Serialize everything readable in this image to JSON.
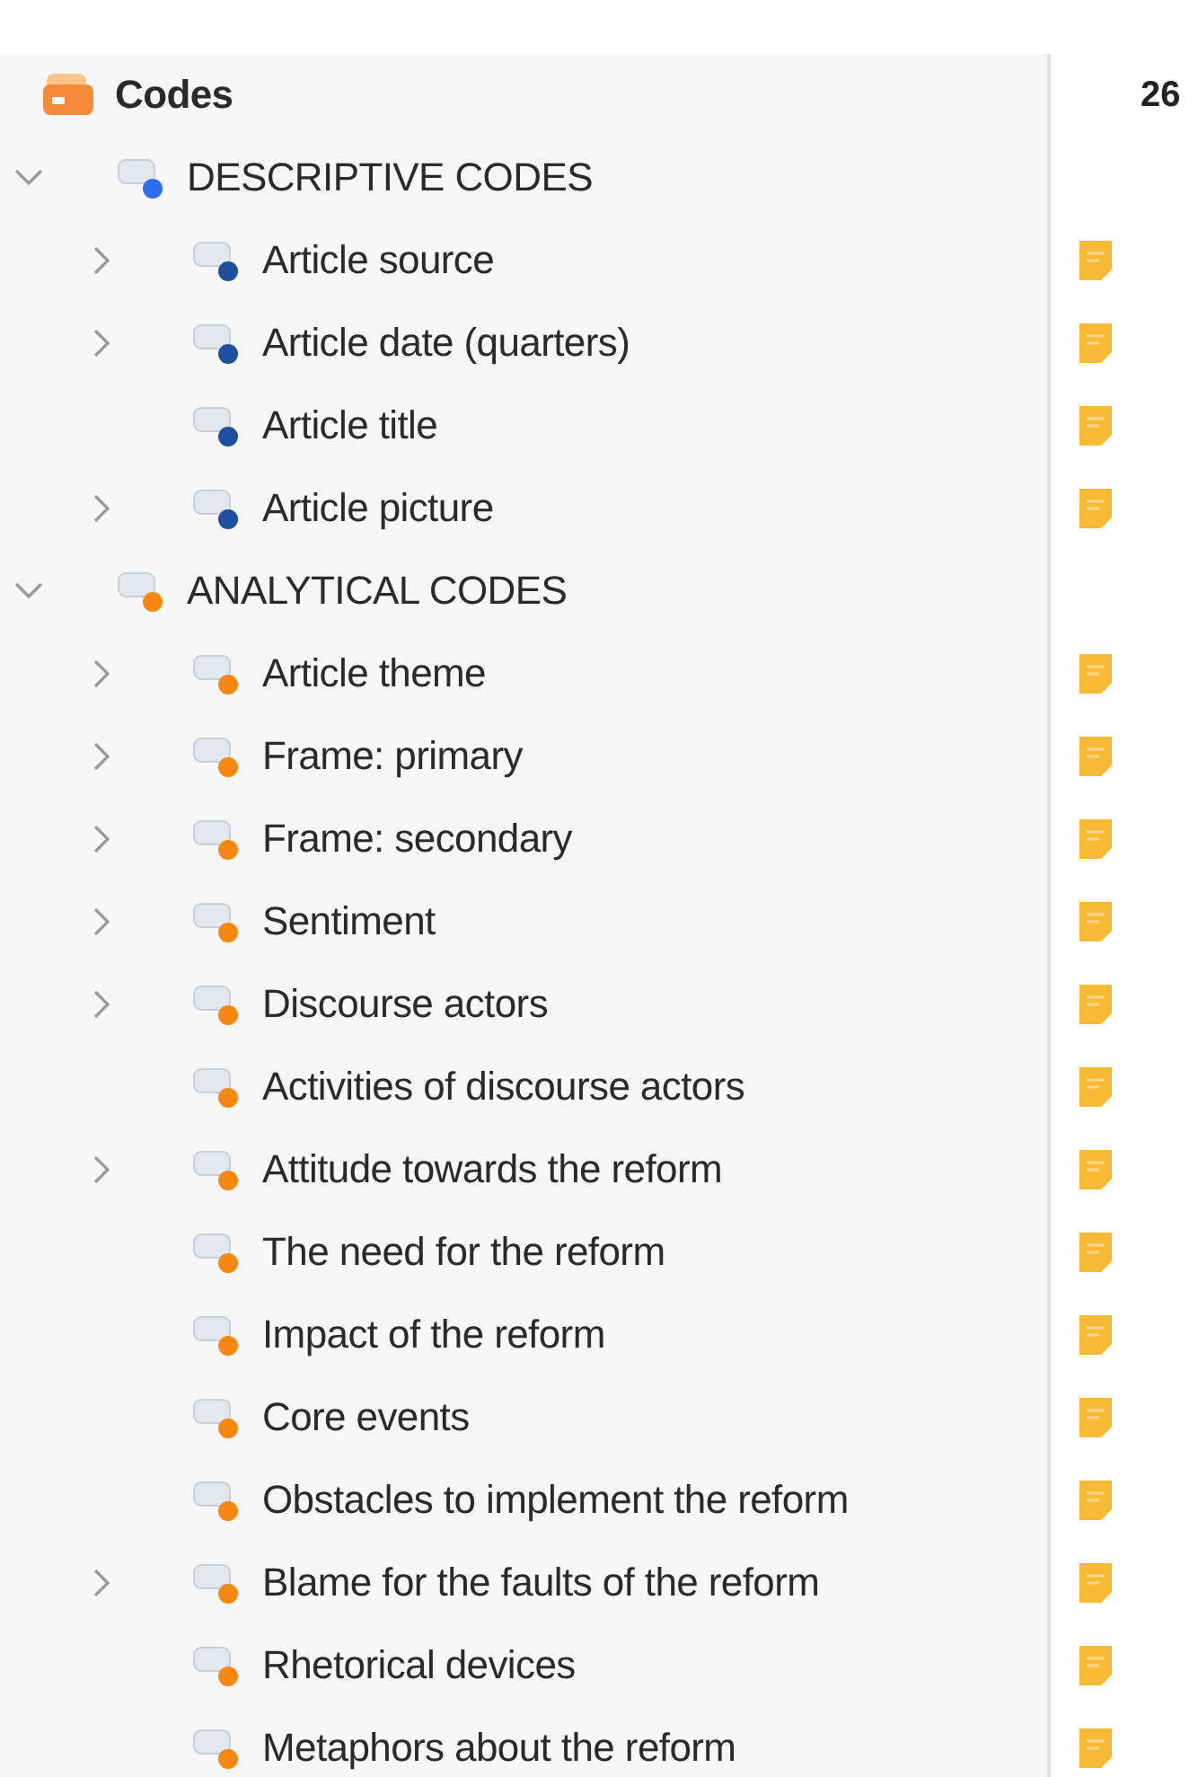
{
  "root": {
    "label": "Codes",
    "count": "26"
  },
  "groups": [
    {
      "label": "DESCRIPTIVE CODES",
      "expanded": true,
      "color": "#2f6df0",
      "children": [
        {
          "label": "Article source",
          "kind": "branch",
          "expanded": false,
          "color": "#1d4f9e",
          "memo": true
        },
        {
          "label": "Article date (quarters)",
          "kind": "branch",
          "expanded": false,
          "color": "#1d4f9e",
          "memo": true
        },
        {
          "label": "Article title",
          "kind": "leaf",
          "color": "#1d4f9e",
          "memo": true
        },
        {
          "label": "Article picture",
          "kind": "branch",
          "expanded": false,
          "color": "#1d4f9e",
          "memo": true
        }
      ]
    },
    {
      "label": "ANALYTICAL CODES",
      "expanded": true,
      "color": "#f7870f",
      "children": [
        {
          "label": "Article theme",
          "kind": "branch",
          "expanded": false,
          "color": "#f7870f",
          "memo": true
        },
        {
          "label": "Frame: primary",
          "kind": "branch",
          "expanded": false,
          "color": "#f7870f",
          "memo": true
        },
        {
          "label": "Frame: secondary",
          "kind": "branch",
          "expanded": false,
          "color": "#f7870f",
          "memo": true
        },
        {
          "label": "Sentiment",
          "kind": "branch",
          "expanded": false,
          "color": "#f7870f",
          "memo": true
        },
        {
          "label": "Discourse actors",
          "kind": "branch",
          "expanded": false,
          "color": "#f7870f",
          "memo": true
        },
        {
          "label": "Activities of discourse actors",
          "kind": "leaf",
          "color": "#f7870f",
          "memo": true
        },
        {
          "label": "Attitude towards the reform",
          "kind": "branch",
          "expanded": false,
          "color": "#f7870f",
          "memo": true
        },
        {
          "label": "The need for the reform",
          "kind": "leaf",
          "color": "#f7870f",
          "memo": true
        },
        {
          "label": "Impact of the reform",
          "kind": "leaf",
          "color": "#f7870f",
          "memo": true
        },
        {
          "label": "Core events",
          "kind": "leaf",
          "color": "#f7870f",
          "memo": true
        },
        {
          "label": "Obstacles to implement the reform",
          "kind": "leaf",
          "color": "#f7870f",
          "memo": true
        },
        {
          "label": "Blame for the faults of the reform",
          "kind": "branch",
          "expanded": false,
          "color": "#f7870f",
          "memo": true
        },
        {
          "label": "Rhetorical devices",
          "kind": "leaf",
          "color": "#f7870f",
          "memo": true
        },
        {
          "label": "Metaphors about the reform",
          "kind": "leaf",
          "color": "#f7870f",
          "memo": true
        }
      ]
    }
  ]
}
